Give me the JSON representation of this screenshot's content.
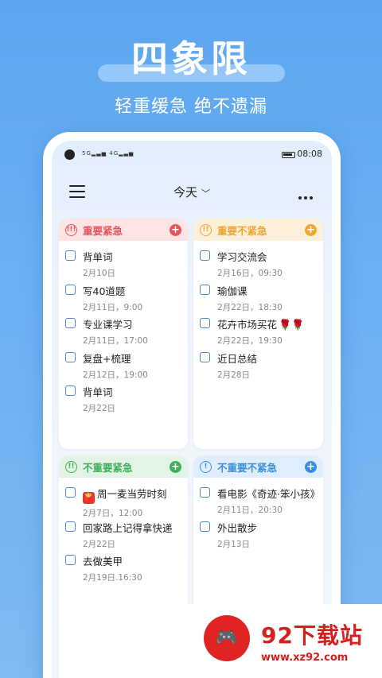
{
  "hero": {
    "title": "四象限",
    "subtitle": "轻重缓急 绝不遗漏"
  },
  "status": {
    "signal_left": "5G",
    "signal_right": "4G",
    "time": "08:08"
  },
  "appbar": {
    "today_label": "今天",
    "chevron": "﹀"
  },
  "quadrants": [
    {
      "title": "重要紧急",
      "icon": "!!!",
      "color": "#e8545a",
      "head_bg": "#fde4e4",
      "tasks": [
        {
          "title": "背单词",
          "date": "2月10日"
        },
        {
          "title": "写40道题",
          "date": "2月11日，9:00"
        },
        {
          "title": "专业课学习",
          "date": "2月11日，17:00"
        },
        {
          "title": "复盘+梳理",
          "date": "2月12日，19:00"
        },
        {
          "title": "背单词",
          "date": "2月22日"
        }
      ]
    },
    {
      "title": "重要不紧急",
      "icon": "!!",
      "color": "#f0a431",
      "head_bg": "#fdf0db",
      "tasks": [
        {
          "title": "学习交流会",
          "date": "2月16日，09:30"
        },
        {
          "title": "瑜伽课",
          "date": "2月22日，18:30"
        },
        {
          "title": "花卉市场买花",
          "date": "2月22日，19:30",
          "roses": "🌹🌹"
        },
        {
          "title": "近日总结",
          "date": "2月28日"
        }
      ]
    },
    {
      "title": "不重要紧急",
      "icon": "!!",
      "color": "#3fae5a",
      "head_bg": "#e2f4e5",
      "tasks": [
        {
          "title": "周一麦当劳时刻",
          "date": "2月7日，12:00",
          "emoji": "fries"
        },
        {
          "title": "回家路上记得拿快递",
          "date": "2月22日"
        },
        {
          "title": "去做美甲",
          "date": "2月19日.16:30"
        }
      ]
    },
    {
      "title": "不重要不紧急",
      "icon": "!",
      "color": "#3b8de0",
      "head_bg": "#dfeefc",
      "tasks": [
        {
          "title": "看电影《奇迹·笨小孩》",
          "date": "2月11日，20:30"
        },
        {
          "title": "外出散步",
          "date": "2月13日"
        }
      ]
    }
  ],
  "watermark": {
    "text": "92下载站",
    "url": "www.xz92.com"
  }
}
